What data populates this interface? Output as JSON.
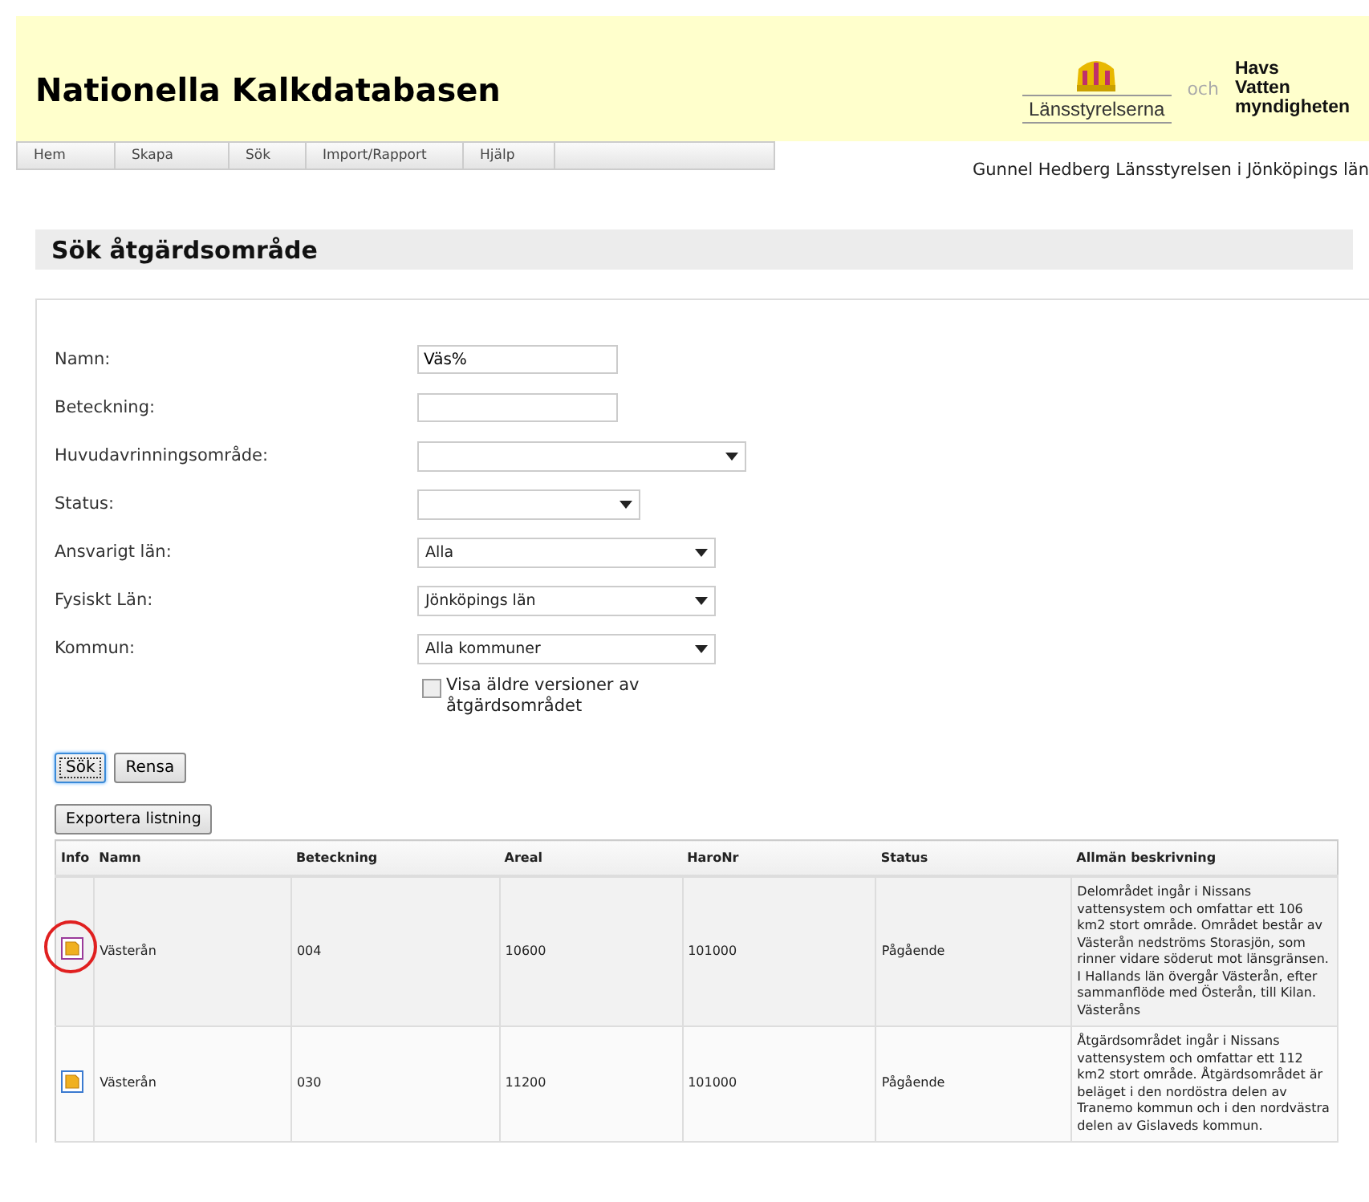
{
  "header": {
    "title": "Nationella Kalkdatabasen",
    "logo_left": "Länsstyrelserna",
    "logo_right": {
      "prefix": "och",
      "lines": [
        "Havs",
        "Vatten",
        "myndigheten"
      ]
    }
  },
  "nav": [
    {
      "label": "Hem"
    },
    {
      "label": "Skapa"
    },
    {
      "label": "Sök"
    },
    {
      "label": "Import/Rapport"
    },
    {
      "label": "Hjälp"
    }
  ],
  "user": "Gunnel Hedberg Länsstyrelsen i Jönköpings län",
  "page_title": "Sök åtgärdsområde",
  "form": {
    "fields": [
      {
        "label": "Namn:",
        "kind": "text",
        "value": "Väs%"
      },
      {
        "label": "Beteckning:",
        "kind": "text"
      },
      {
        "label": "Huvudavrinningsområde:",
        "kind": "select"
      },
      {
        "label": "Status:",
        "kind": "select"
      },
      {
        "label": "Ansvarigt län:",
        "kind": "select",
        "value": "Alla"
      },
      {
        "label": "Fysiskt Län:",
        "kind": "select",
        "value": "Jönköpings län"
      },
      {
        "label": "Kommun:",
        "kind": "select",
        "value": "Alla kommuner"
      }
    ],
    "checkbox": {
      "label": "Visa äldre versioner av åtgärdsområdet",
      "checked": false
    },
    "buttons": [
      {
        "label": "Sök",
        "focused": true
      },
      {
        "label": "Rensa",
        "focused": false
      }
    ]
  },
  "export_button": "Exportera listning",
  "table": {
    "columns": [
      "Info",
      "Namn",
      "Beteckning",
      "Areal",
      "HaroNr",
      "Status",
      "Allmän beskrivning"
    ],
    "rows": [
      {
        "circled": true,
        "cells": [
          "",
          "Västerån",
          "004",
          "10600",
          "101000",
          "Pågående",
          "Delområdet ingår i Nissans vattensystem och omfattar ett 106 km2 stort område. Området består av Västerån nedströms Storasjön, som rinner vidare söderut mot länsgränsen. I Hallands län övergår Västerån, efter sammanflöde med Österån, till Kilan. Västeråns"
        ]
      },
      {
        "circled": false,
        "cells": [
          "",
          "Västerån",
          "030",
          "11200",
          "101000",
          "Pågående",
          "Åtgärdsområdet ingår i Nissans vattensystem och omfattar ett 112 km2 stort område. Åtgärdsområdet är beläget i den nordöstra delen av Tranemo kommun och i den nordvästra delen av Gislaveds kommun."
        ]
      }
    ]
  }
}
